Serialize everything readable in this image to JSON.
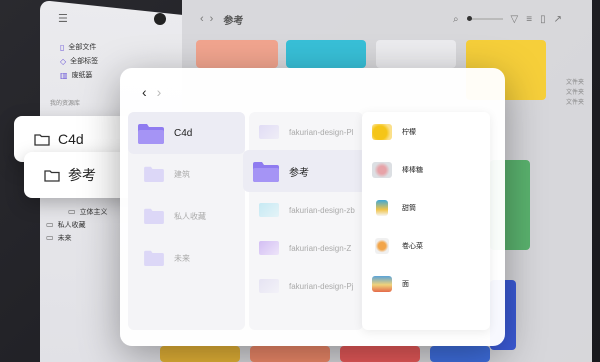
{
  "background_app": {
    "title": "参考",
    "nav_back": "‹",
    "nav_forward": "›",
    "menu_icon": "menu-icon",
    "sidebar": {
      "items": [
        {
          "icon": "files-icon",
          "label": "全部文件"
        },
        {
          "icon": "tag-icon",
          "label": "全部标签"
        },
        {
          "icon": "trash-icon",
          "label": "废纸篓"
        }
      ],
      "section_label": "我的资源库",
      "lower_items": [
        {
          "label": "立体主义",
          "indent": true
        },
        {
          "label": "私人收藏",
          "indent": false
        },
        {
          "label": "未来",
          "indent": false
        }
      ]
    },
    "right_labels": [
      "文件夹",
      "文件夹",
      "文件夹"
    ]
  },
  "floating_cards": [
    {
      "label": "C4d"
    },
    {
      "label": "参考"
    }
  ],
  "dialog": {
    "back": "‹",
    "forward": "›",
    "column1": [
      {
        "label": "C4d",
        "selected": true
      },
      {
        "label": "建筑",
        "selected": false
      },
      {
        "label": "私人收藏",
        "selected": false
      },
      {
        "label": "未来",
        "selected": false
      }
    ],
    "column2": [
      {
        "type": "file",
        "label": "fakurian-design-Pl"
      },
      {
        "type": "folder",
        "label": "参考",
        "selected": true
      },
      {
        "type": "file",
        "label": "fakurian-design-zb"
      },
      {
        "type": "file",
        "label": "fakurian-design-Z"
      },
      {
        "type": "file",
        "label": "fakurian-design-Pj"
      }
    ],
    "column3": [
      {
        "label": "柠檬",
        "color": "#f5c518"
      },
      {
        "label": "棒棒糖",
        "color": "#e7a3a8"
      },
      {
        "label": "甜筒",
        "color": "#f0c44a"
      },
      {
        "label": "卷心菜",
        "color": "#f2a54a"
      },
      {
        "label": "面",
        "color": "#5aa3d8"
      }
    ]
  },
  "colors": {
    "folder_purple": "#8f7bf0",
    "accent": "#6a55d8"
  }
}
